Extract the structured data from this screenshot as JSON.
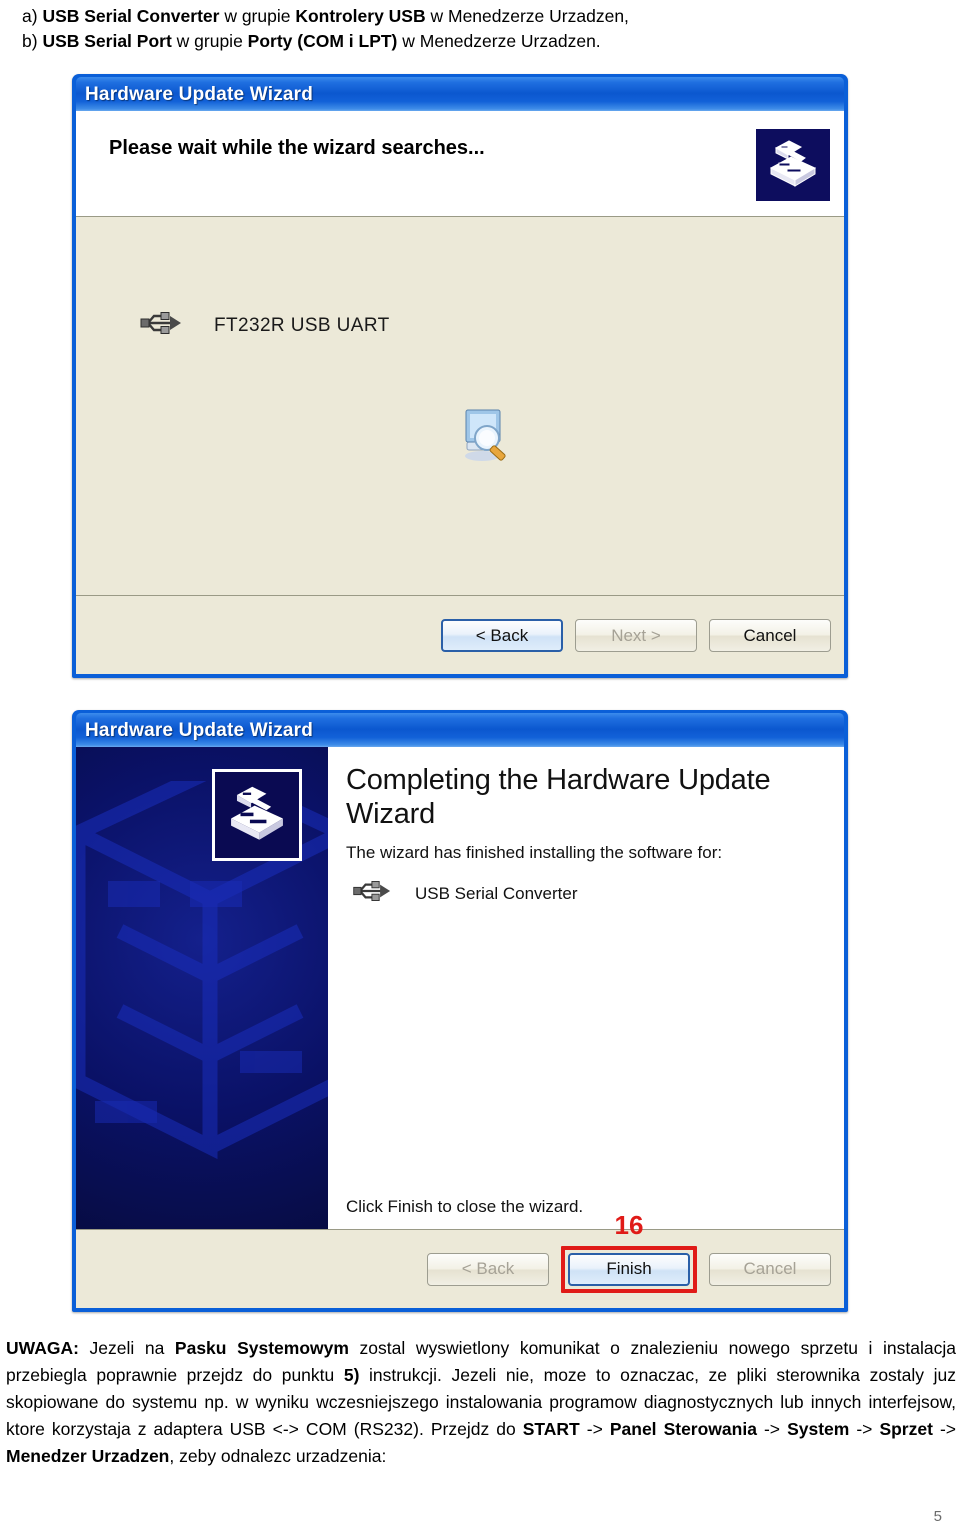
{
  "document": {
    "intro": {
      "line_a_prefix": "a) ",
      "line_a_bold1": "USB Serial Converter",
      "line_a_mid": " w grupie ",
      "line_a_bold2": "Kontrolery USB",
      "line_a_suffix": " w Menedzerze Urzadzen,",
      "line_b_prefix": "b) ",
      "line_b_bold1": "USB Serial Port",
      "line_b_mid": " w grupie ",
      "line_b_bold2": "Porty (COM i LPT)",
      "line_b_suffix": " w Menedzerze Urzadzen."
    },
    "note": {
      "label": "UWAGA:",
      "t1": " Jezeli na ",
      "b1": "Pasku Systemowym",
      "t2": " zostal wyswietlony komunikat o znalezieniu nowego sprzetu i instalacja przebiegla poprawnie przejdz do punktu ",
      "b2": "5)",
      "t3": " instrukcji. Jezeli nie, moze to oznaczac, ze pliki sterownika zostaly juz skopiowane do systemu np. w wyniku wczesniejszego instalowania programow diagnostycznych lub innych interfejsow, ktore korzystaja z adaptera USB <-> COM (RS232). Przejdz do ",
      "b3": "START",
      "t4": " -> ",
      "b4": "Panel Sterowania",
      "t5": "  -> ",
      "b5": "System",
      "t6": " -> ",
      "b6": "Sprzet",
      "t7": " -> ",
      "b7": "Menedzer Urzadzen",
      "t8": ", zeby odnalezc urzadzenia:"
    },
    "page_number": "5"
  },
  "dialog_search": {
    "title": "Hardware Update Wizard",
    "header_title": "Please wait while the wizard searches...",
    "device_name": "FT232R USB UART",
    "header_icon": "hardware-wizard-icon",
    "device_icon": "usb-device-icon",
    "search_icon": "search-computer-icon",
    "buttons": {
      "back": "< Back",
      "next": "Next >",
      "cancel": "Cancel"
    }
  },
  "dialog_finish": {
    "title": "Hardware Update Wizard",
    "heading": "Completing the Hardware Update Wizard",
    "subtitle": "The wizard has finished installing the software for:",
    "device_name": "USB Serial Converter",
    "device_icon": "usb-device-icon",
    "banner_icon": "hardware-wizard-icon",
    "footer_text": "Click Finish to close the wizard.",
    "callout_number": "16",
    "buttons": {
      "back": "< Back",
      "finish": "Finish",
      "cancel": "Cancel"
    }
  },
  "colors": {
    "titlebar_blue": "#0b57cf",
    "dialog_frame": "#0a5fd8",
    "client_beige": "#ece9d8",
    "wizard_panel_navy": "#0a1166",
    "callout_red": "#e01b18",
    "default_button_border": "#2a5fa8"
  }
}
